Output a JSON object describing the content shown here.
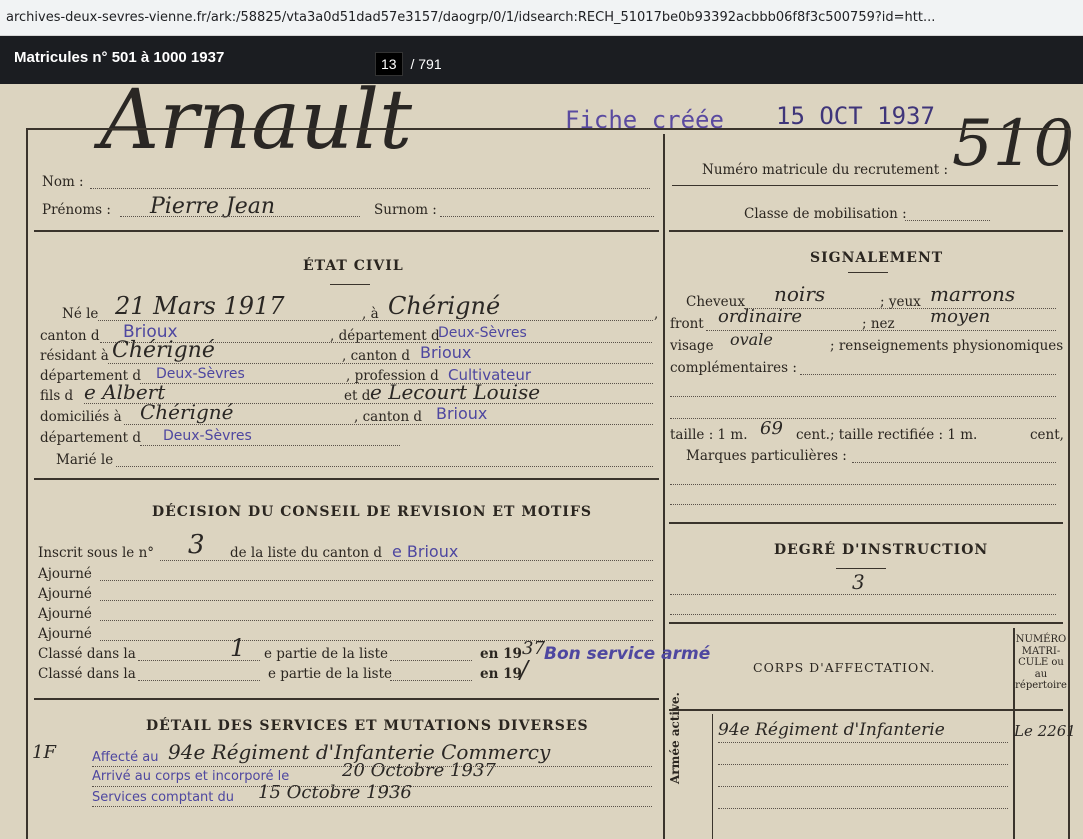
{
  "browser": {
    "url": "archives-deux-sevres-vienne.fr/ark:/58825/vta3a0d51dad57e3157/daogrp/0/1/idsearch:RECH_51017be0b93392acbbb06f8f3c500759?id=htt..."
  },
  "viewer": {
    "title": "Matricules n° 501 à 1000 1937",
    "page_current": "13",
    "page_total": "/ 791"
  },
  "record": {
    "header": {
      "fiche_stamp": "Fiche créée",
      "fiche_date": "15 OCT 1937",
      "nom_label": "Nom :",
      "nom_value": "Arnault",
      "prenoms_label": "Prénoms :",
      "prenoms_value": "Pierre Jean",
      "surnom_label": "Surnom :",
      "matricule_label": "Numéro matricule du recrutement :",
      "matricule_value": "510",
      "classe_label": "Classe de mobilisation :"
    },
    "etat_civil": {
      "title": "ÉTAT CIVIL",
      "ne_le_label": "Né le",
      "ne_le_value": "21 Mars 1917",
      "a_label": ", à",
      "a_value": "Chérigné",
      "canton_label": "canton d",
      "canton_value": "Brioux",
      "departement_label": ", département d",
      "departement_value": "Deux-Sèvres",
      "residant_label": "résidant à",
      "residant_value": "Chérigné",
      "canton2_label": ", canton d",
      "canton2_value": "Brioux",
      "departement2_label": "département d",
      "departement2_value": "Deux-Sèvres",
      "profession_label": ", profession d",
      "profession_value": "Cultivateur",
      "fils_label": "fils d",
      "fils_value": "e Albert",
      "et_label": "et d",
      "et_value": "e Lecourt Louise",
      "domicilies_label": "domiciliés à",
      "domicilies_value": "Chérigné",
      "canton3_label": ", canton d",
      "canton3_value": "Brioux",
      "departement3_label": "département d",
      "departement3_value": "Deux-Sèvres",
      "marie_label": "Marié le"
    },
    "signalement": {
      "title": "SIGNALEMENT",
      "cheveux_label": "Cheveux",
      "cheveux_value": "noirs",
      "yeux_label": "; yeux",
      "yeux_value": "marrons",
      "front_label": "front",
      "front_value": "ordinaire",
      "nez_label": "; nez",
      "nez_value": "moyen",
      "visage_label": "visage",
      "visage_value": "ovale",
      "renseignements_label": "; renseignements physionomiques",
      "complementaires_label": "complémentaires :",
      "taille_label": "taille : 1 m.",
      "taille_value": "69",
      "taille_suffix": "cent.; taille rectifiée : 1 m.",
      "cent_label": "cent,",
      "marques_label": "Marques particulières :"
    },
    "conseil": {
      "title": "DÉCISION DU CONSEIL DE REVISION ET MOTIFS",
      "inscrit_label": "Inscrit sous le n°",
      "inscrit_value": "3",
      "liste_label": "de la liste du canton d",
      "liste_value": "e Brioux",
      "ajourne_label": "Ajourné",
      "classe_label": "Classé dans la",
      "classe_value": "1",
      "partie_label": "e partie de la liste",
      "en19_label": "en 19",
      "en19_value": "37",
      "bon_service": "Bon service armé",
      "classe2_label": "Classé dans la",
      "partie2_label": "e partie de la liste",
      "en19b_label": "en 19"
    },
    "instruction": {
      "title": "DEGRÉ D'INSTRUCTION",
      "value": "3"
    },
    "corps": {
      "title": "CORPS D'AFFECTATION.",
      "numero_label": "NUMÉRO MATRI- CULE ou au répertoire",
      "armee_label": "Armée active.",
      "corps_value": "94e Régiment d'Infanterie",
      "numero_value": "Le 2261"
    },
    "services": {
      "title": "DÉTAIL DES SERVICES ET MUTATIONS DIVERSES",
      "margin_note": "1F",
      "line1": "Affecté au",
      "line1_hand": "94e Régiment d'Infanterie Commercy",
      "line2": "Arrivé au corps et incorporé le",
      "line2_hand": "20 Octobre 1937",
      "line3": "Services comptant du",
      "line3_hand": "15 Octobre 1936"
    }
  }
}
